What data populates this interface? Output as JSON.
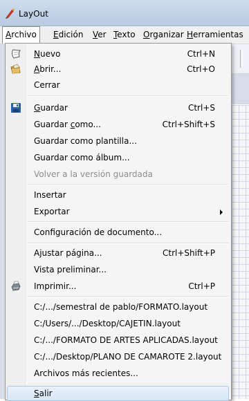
{
  "window": {
    "title": "LayOut"
  },
  "menubar": [
    {
      "label": "Archivo",
      "accel": "A",
      "rest": "rchivo",
      "active": true
    },
    {
      "label": "Edición",
      "accel": "E",
      "rest": "dición"
    },
    {
      "label": "Ver",
      "accel": "V",
      "rest": "er"
    },
    {
      "label": "Texto",
      "accel": "T",
      "rest": "exto"
    },
    {
      "label": "Organizar",
      "accel": "O",
      "rest": "rganizar"
    },
    {
      "label": "Herramientas",
      "accel": "H",
      "rest": "erramientas"
    }
  ],
  "menu": {
    "nuevo": {
      "accel": "N",
      "rest": "uevo",
      "shortcut": "Ctrl+N",
      "icon": "new-document-icon"
    },
    "abrir": {
      "accel": "A",
      "rest": "brir...",
      "shortcut": "Ctrl+O",
      "icon": "open-folder-icon"
    },
    "cerrar": {
      "label": "Cerrar"
    },
    "guardar": {
      "accel": "G",
      "rest": "uardar",
      "shortcut": "Ctrl+S",
      "icon": "save-disk-icon"
    },
    "guardar_como": {
      "pre": "Guardar ",
      "accel": "c",
      "rest": "omo...",
      "shortcut": "Ctrl+Shift+S"
    },
    "guardar_plantilla": {
      "label": "Guardar como plantilla..."
    },
    "guardar_album": {
      "label": "Guardar como álbum..."
    },
    "volver": {
      "label": "Volver a la versión guardada",
      "disabled": true
    },
    "insertar": {
      "label": "Insertar"
    },
    "exportar": {
      "label": "Exportar",
      "submenu": true
    },
    "configuracion": {
      "label": "Configuración de documento..."
    },
    "ajustar": {
      "label": "Ajustar página...",
      "shortcut": "Ctrl+Shift+P"
    },
    "vista": {
      "label": "Vista preliminar..."
    },
    "imprimir": {
      "label": "Imprimir...",
      "shortcut": "Ctrl+P",
      "icon": "printer-icon"
    },
    "recent": [
      "C:/.../semestral de pablo/FORMATO.layout",
      "C:/Users/.../Desktop/CAJETIN.layout",
      "C:/.../FORMATO DE ARTES APLICADAS.layout",
      "C:/.../Desktop/PLANO DE CAMAROTE 2.layout"
    ],
    "mas_recientes": {
      "label": "Archivos más recientes..."
    },
    "salir": {
      "accel": "S",
      "rest": "alir",
      "highlighted": true
    }
  },
  "colors": {
    "highlight_border": "#a9c7e9",
    "save_icon": "#2a5ea8"
  }
}
